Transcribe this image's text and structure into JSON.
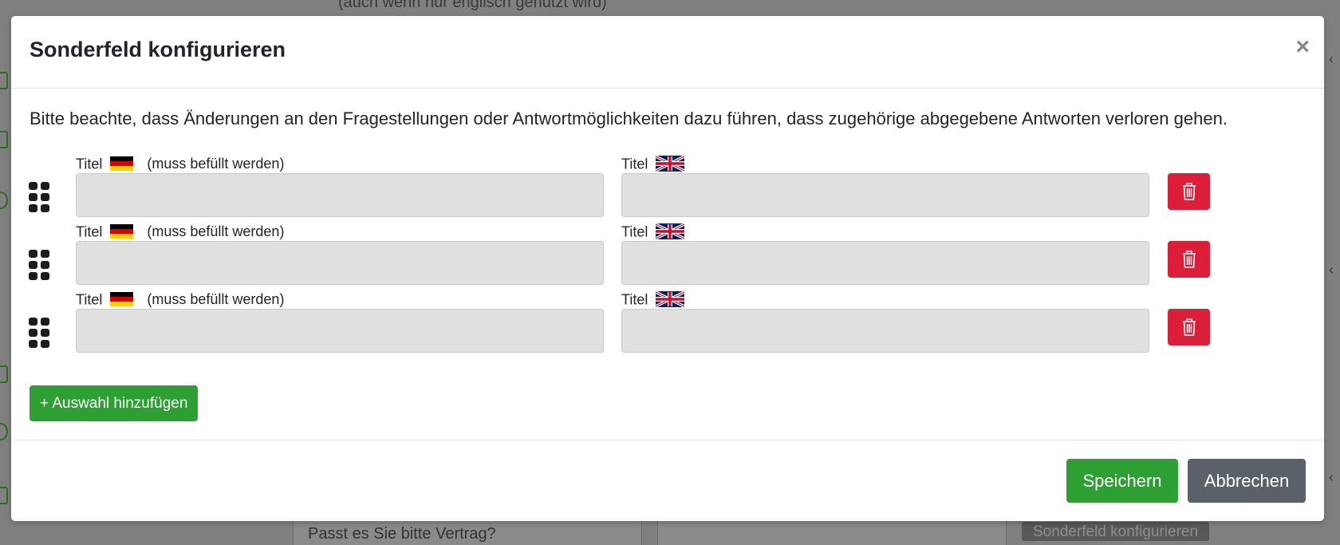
{
  "background": {
    "top_text": "(auch wenn nur englisch genutzt wird)",
    "bottom_text": "Passt es Sie bitte Vertrag?",
    "bottom_button": "Sonderfeld konfigurieren"
  },
  "modal": {
    "title": "Sonderfeld konfigurieren",
    "close_label": "×",
    "notice": "Bitte beachte, dass Änderungen an den Fragestellungen oder Antwortmöglichkeiten dazu führen, dass zugehörige abgegebene Antworten verloren gehen.",
    "rows": [
      {
        "de_label": "Titel",
        "de_required": "(muss befüllt werden)",
        "de_value": "",
        "en_label": "Titel",
        "en_value": ""
      },
      {
        "de_label": "Titel",
        "de_required": "(muss befüllt werden)",
        "de_value": "",
        "en_label": "Titel",
        "en_value": ""
      },
      {
        "de_label": "Titel",
        "de_required": "(muss befüllt werden)",
        "de_value": "",
        "en_label": "Titel",
        "en_value": ""
      }
    ],
    "add_button": "+ Auswahl hinzufügen",
    "save_button": "Speichern",
    "cancel_button": "Abbrechen"
  },
  "colors": {
    "primary_green": "#2e9f33",
    "danger_red": "#dc1e38",
    "secondary_gray": "#5a6169",
    "input_bg": "#e0e0e0"
  },
  "icons": [
    "drag-handle-icon",
    "trash-icon",
    "close-icon",
    "german-flag-icon",
    "uk-flag-icon"
  ]
}
